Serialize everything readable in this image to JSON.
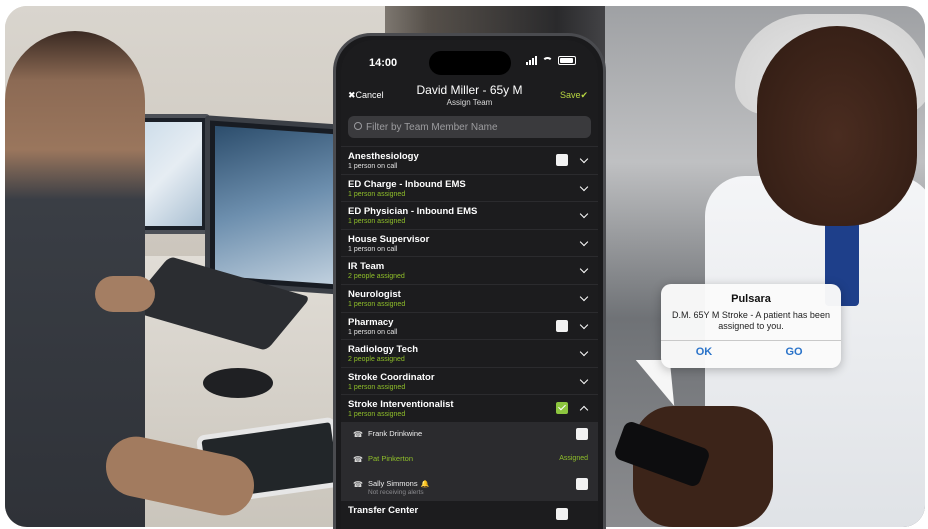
{
  "status_bar": {
    "time": "14:00"
  },
  "nav": {
    "cancel_label": "Cancel",
    "title": "David Miller - 65y M",
    "subtitle": "Assign Team",
    "save_label": "Save"
  },
  "search": {
    "placeholder": "Filter by Team Member Name"
  },
  "teams": [
    {
      "name": "Anesthesiology",
      "status": "1 person on call",
      "status_color": "white",
      "has_checkbox": true,
      "checked": false,
      "expanded": false
    },
    {
      "name": "ED Charge - Inbound EMS",
      "status": "1 person assigned",
      "status_color": "green",
      "has_checkbox": false,
      "expanded": false
    },
    {
      "name": "ED Physician - Inbound EMS",
      "status": "1 person assigned",
      "status_color": "green",
      "has_checkbox": false,
      "expanded": false
    },
    {
      "name": "House Supervisor",
      "status": "1 person on call",
      "status_color": "white",
      "has_checkbox": false,
      "expanded": false
    },
    {
      "name": "IR Team",
      "status": "2 people assigned",
      "status_color": "green",
      "has_checkbox": false,
      "expanded": false
    },
    {
      "name": "Neurologist",
      "status": "1 person assigned",
      "status_color": "green",
      "has_checkbox": false,
      "expanded": false
    },
    {
      "name": "Pharmacy",
      "status": "1 person on call",
      "status_color": "white",
      "has_checkbox": true,
      "checked": false,
      "expanded": false
    },
    {
      "name": "Radiology Tech",
      "status": "2 people assigned",
      "status_color": "green",
      "has_checkbox": false,
      "expanded": false
    },
    {
      "name": "Stroke Coordinator",
      "status": "1 person assigned",
      "status_color": "green",
      "has_checkbox": false,
      "expanded": false
    },
    {
      "name": "Stroke Interventionalist",
      "status": "1 person assigned",
      "status_color": "green",
      "has_checkbox": true,
      "checked": true,
      "expanded": true
    }
  ],
  "members": [
    {
      "name": "Frank Drinkwine",
      "assigned": false,
      "note": ""
    },
    {
      "name": "Pat Pinkerton",
      "assigned": true,
      "status": "Assigned",
      "note": ""
    },
    {
      "name": "Sally Simmons",
      "assigned": false,
      "note": "Not receiving alerts",
      "alert_icon": "bell-icon"
    }
  ],
  "last_team": {
    "name": "Transfer Center"
  },
  "notification": {
    "title": "Pulsara",
    "message": "D.M. 65Y M Stroke - A patient has been assigned to you.",
    "ok_label": "OK",
    "go_label": "GO"
  },
  "colors": {
    "accent_green": "#8dc63f",
    "link_blue": "#2a73c9",
    "screen_bg": "#1c1c1e"
  }
}
